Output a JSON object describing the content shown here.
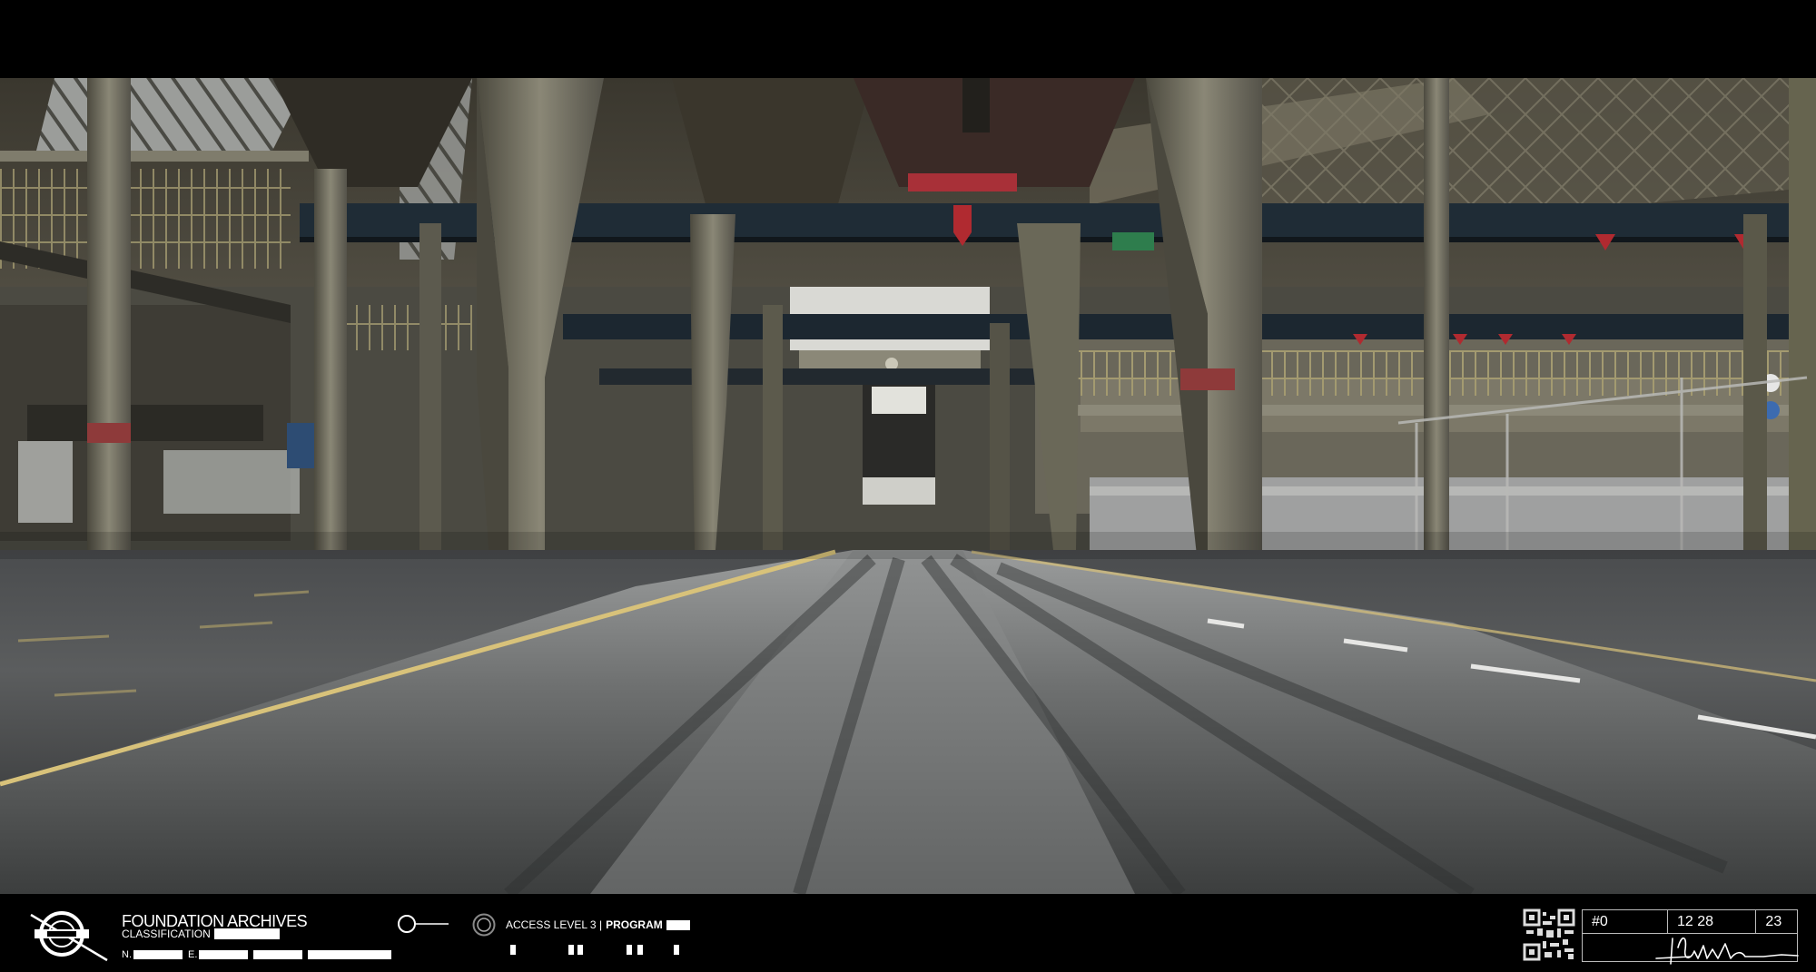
{
  "hud": {
    "org_title": "FOUNDATION ARCHIVES",
    "classification_label": "CLASSIFICATION",
    "n_letter": "N.",
    "e_letter": "E.",
    "access_level": "ACCESS LEVEL 3 |",
    "program_label": "PROGRAM",
    "record_number": "#0",
    "time": "12 28",
    "day": "23"
  },
  "icons": [
    "foundation-logo-icon",
    "toggle-switch-icon",
    "target-circle-icon",
    "qr-code-icon",
    "signature-icon"
  ],
  "colors": {
    "hud_background": "#000000",
    "hud_text": "#ffffff",
    "floor_line": "#d8c27a",
    "column": "#6c6a5c",
    "beam": "#1f2c36",
    "accent_red": "#b02a30"
  }
}
